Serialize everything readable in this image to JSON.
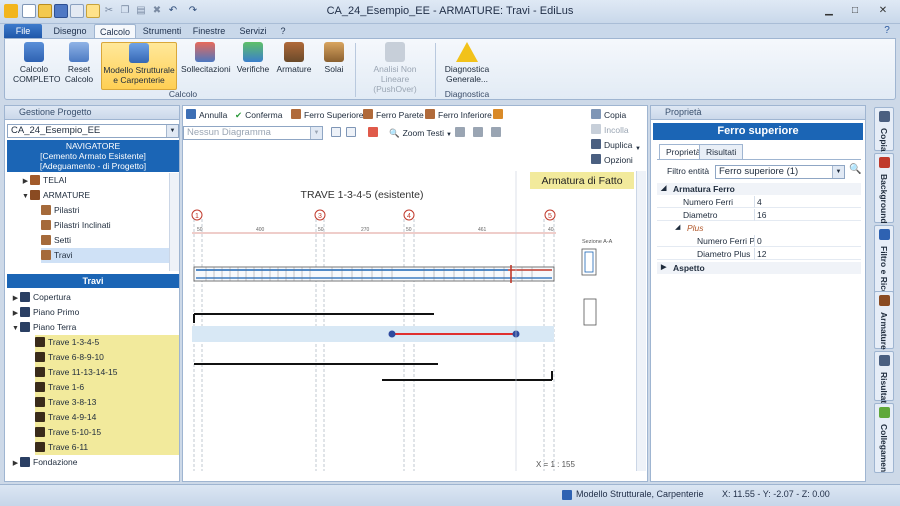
{
  "window": {
    "title": "CA_24_Esempio_EE  -  ARMATURE: Travi - EdiLus",
    "controls": {
      "minimize": "▁",
      "maximize": "□",
      "close": "✕"
    }
  },
  "ribbon_tabs": [
    "File",
    "Disegno",
    "Calcolo",
    "Strumenti",
    "Finestre",
    "Servizi",
    "?"
  ],
  "ribbon": {
    "buttons": [
      {
        "label": "Calcolo COMPLETO",
        "icon": "calculator-icon"
      },
      {
        "label": "Reset Calcolo",
        "icon": "reset-icon"
      },
      {
        "label": "Modello Strutturale e Carpenterie",
        "icon": "model-icon"
      },
      {
        "label": "Sollecitazioni",
        "icon": "stress-icon"
      },
      {
        "label": "Verifiche",
        "icon": "check-icon"
      },
      {
        "label": "Armature",
        "icon": "rebar-icon"
      },
      {
        "label": "Solai",
        "icon": "slab-icon"
      },
      {
        "label": "Analisi Non Lineare (PushOver)",
        "icon": "pushover-icon"
      },
      {
        "label": "Diagnostica Generale...",
        "icon": "warning-icon"
      }
    ],
    "groups": {
      "calcolo": "Calcolo",
      "diagnostica": "Diagnostica"
    }
  },
  "left_panel": {
    "title": "Gestione Progetto",
    "project": "CA_24_Esempio_EE",
    "navigator": [
      "NAVIGATORE",
      "[Cemento Armato Esistente]",
      "[Adeguamento - di Progetto]"
    ],
    "tree": [
      "TELAI",
      "ARMATURE",
      "Pilastri",
      "Pilastri Inclinati",
      "Setti",
      "Travi"
    ],
    "travi_header": "Travi",
    "travi_tree": [
      "Copertura",
      "Piano Primo",
      "Piano Terra",
      "Trave 1-3-4-5",
      "Trave 6-8-9-10",
      "Trave 11-13-14-15",
      "Trave 1-6",
      "Trave 3-8-13",
      "Trave 4-9-14",
      "Trave 5-10-15",
      "Trave 6-11",
      "Fondazione"
    ]
  },
  "center": {
    "toolbar": {
      "annulla": "Annulla",
      "conferma": "Conferma",
      "ferro_superiore": "Ferro Superiore",
      "ferro_parete": "Ferro Parete",
      "ferro_inferiore": "Ferro Inferiore",
      "diagram_placeholder": "Nessun Diagramma",
      "zoom": "Zoom Testi",
      "copia": "Copia",
      "incolla": "Incolla",
      "duplica": "Duplica",
      "opzioni": "Opzioni"
    },
    "drawing": {
      "title": "TRAVE 1-3-4-5 (esistente)",
      "badge": "Armatura di Fatto",
      "section": "Sezione A-A",
      "axes": [
        "1",
        "3",
        "4",
        "5"
      ],
      "dims": [
        "50",
        "400",
        "50",
        "270",
        "50",
        "461",
        "40"
      ],
      "scale": "X = 1 : 155"
    }
  },
  "right_panel": {
    "title": "Proprietà",
    "header": "Ferro superiore",
    "tabs": [
      "Proprietà",
      "Risultati"
    ],
    "filter_label": "Filtro entità",
    "filter_value": "Ferro superiore (1)",
    "sections": {
      "armatura": "Armatura Ferro",
      "plus": "Plus",
      "aspetto": "Aspetto"
    },
    "props": [
      {
        "k": "Numero Ferri",
        "v": "4"
      },
      {
        "k": "Diametro",
        "v": "16"
      },
      {
        "k": "Numero Ferri Plus",
        "v": "0"
      },
      {
        "k": "Diametro Plus",
        "v": "12"
      }
    ]
  },
  "side_tabs": [
    "Copia",
    "Background",
    "Filtro e Ricerca",
    "Armature",
    "Risultati",
    "Collegamen"
  ],
  "statusbar": {
    "mode": "Modello Strutturale, Carpenterie",
    "coords": "X: 11.55 - Y: -2.07 - Z: 0.00"
  }
}
